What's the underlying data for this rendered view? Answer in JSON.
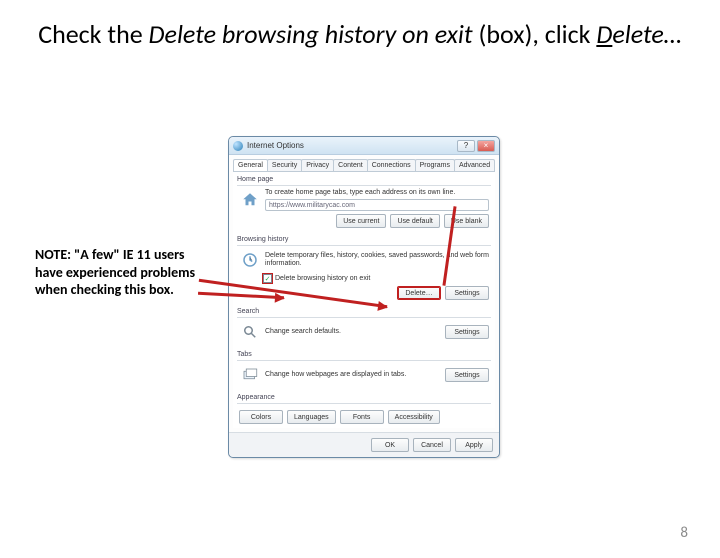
{
  "title": {
    "pre": "Check the ",
    "italic1": "Delete bro",
    "italic1b": "wsing history on exit ",
    "mid": "(box), click ",
    "italic2_u": "D",
    "italic2": "elete…"
  },
  "note": "NOTE:  \"A few\" IE 11 users have experienced problems when checking this box.",
  "page_number": "8",
  "window": {
    "title": "Internet Options",
    "tabs": [
      "General",
      "Security",
      "Privacy",
      "Content",
      "Connections",
      "Programs",
      "Advanced"
    ],
    "home": {
      "group": "Home page",
      "desc": "To create home page tabs, type each address on its own line.",
      "url": "https://www.militarycac.com"
    },
    "buttons_home": {
      "current": "Use current",
      "default": "Use default",
      "blank": "Use blank"
    },
    "history": {
      "group": "Browsing history",
      "desc": "Delete temporary files, history, cookies, saved passwords, and web form information.",
      "checkbox_label": "Delete browsing history on exit",
      "checked": true,
      "delete_btn": "Delete…",
      "settings_btn": "Settings"
    },
    "search": {
      "group": "Search",
      "desc": "Change search defaults.",
      "settings_btn": "Settings"
    },
    "tabs_section": {
      "group": "Tabs",
      "desc": "Change how webpages are displayed in tabs.",
      "settings_btn": "Settings"
    },
    "appearance": {
      "group": "Appearance",
      "colors": "Colors",
      "languages": "Languages",
      "fonts": "Fonts",
      "access": "Accessibility"
    },
    "footer": {
      "ok": "OK",
      "cancel": "Cancel",
      "apply": "Apply"
    }
  }
}
